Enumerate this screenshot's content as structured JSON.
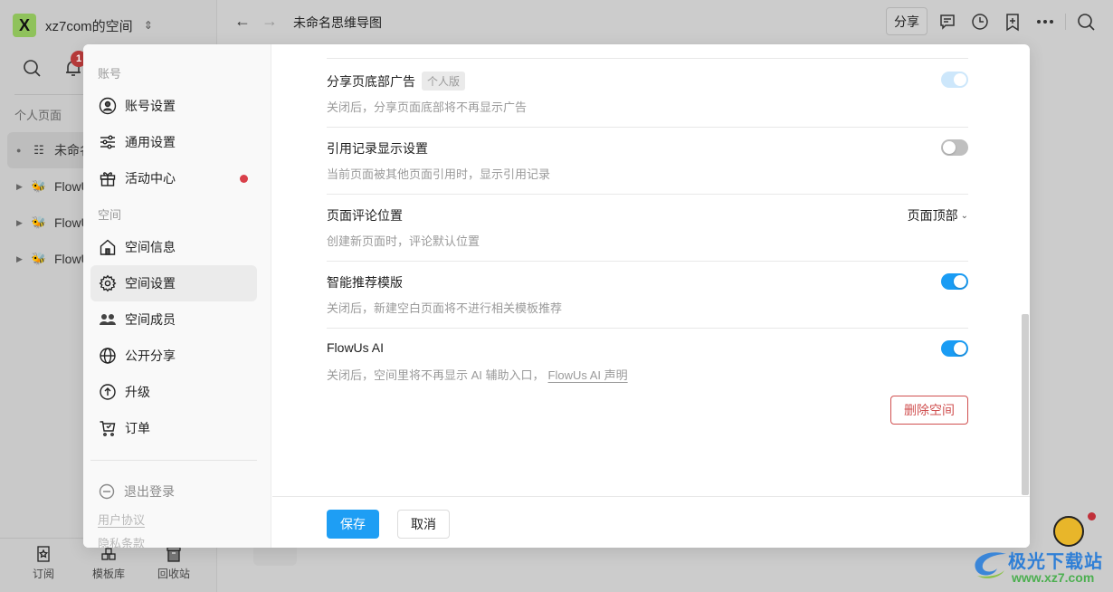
{
  "app": {
    "workspace": {
      "logo_letter": "X",
      "name": "xz7com的空间",
      "chevron": "⌃⌄"
    },
    "notification_count": "1",
    "sidebar_section": "个人页面",
    "pages": [
      {
        "label": "未命名思维导图",
        "active": true
      },
      {
        "label": "FlowUs"
      },
      {
        "label": "FlowUs"
      },
      {
        "label": "FlowUs"
      }
    ],
    "bottom_nav": [
      {
        "label": "订阅",
        "icon": "subscribe-icon"
      },
      {
        "label": "模板库",
        "icon": "template-icon"
      },
      {
        "label": "回收站",
        "icon": "trash-icon"
      }
    ]
  },
  "topbar": {
    "back": "←",
    "forward": "→",
    "title": "未命名思维导图",
    "share_label": "分享",
    "icons": [
      "comment-icon",
      "history-icon",
      "bookmark-add-icon",
      "more-icon",
      "search-icon"
    ]
  },
  "modal": {
    "nav": {
      "account_group": "账号",
      "space_group": "空间",
      "items": [
        {
          "label": "账号设置",
          "icon": "user-circle-icon"
        },
        {
          "label": "通用设置",
          "icon": "sliders-icon"
        },
        {
          "label": "活动中心",
          "icon": "gift-icon",
          "has_dot": true
        },
        {
          "label": "空间信息",
          "icon": "home-icon"
        },
        {
          "label": "空间设置",
          "icon": "gear-icon",
          "active": true
        },
        {
          "label": "空间成员",
          "icon": "members-icon"
        },
        {
          "label": "公开分享",
          "icon": "globe-icon"
        },
        {
          "label": "升级",
          "icon": "upgrade-icon"
        },
        {
          "label": "订单",
          "icon": "cart-icon"
        }
      ],
      "logout": "退出登录",
      "user_agreement": "用户协议",
      "privacy": "隐私条款"
    },
    "settings": [
      {
        "title": "分享页底部广告",
        "tag": "个人版",
        "desc": "关闭后，分享页面底部将不再显示广告",
        "control": "toggle",
        "state": "on-disabled"
      },
      {
        "title": "引用记录显示设置",
        "desc": "当前页面被其他页面引用时，显示引用记录",
        "control": "toggle",
        "state": "off"
      },
      {
        "title": "页面评论位置",
        "desc": "创建新页面时，评论默认位置",
        "control": "select",
        "value": "页面顶部"
      },
      {
        "title": "智能推荐模版",
        "desc": "关闭后，新建空白页面将不进行相关模板推荐",
        "control": "toggle",
        "state": "on"
      },
      {
        "title": "FlowUs AI",
        "desc": "关闭后，空间里将不再显示 AI 辅助入口，",
        "desc_link": "FlowUs AI 声明",
        "control": "toggle",
        "state": "on"
      }
    ],
    "delete_space": "删除空间",
    "save": "保存",
    "cancel": "取消"
  },
  "watermark": {
    "text": "极光下载站",
    "url": "www.xz7.com"
  },
  "colors": {
    "accent": "#1e9ef4",
    "danger": "#d05050",
    "badge": "#b83a3a",
    "workspace_logo": "#8fc25b"
  }
}
